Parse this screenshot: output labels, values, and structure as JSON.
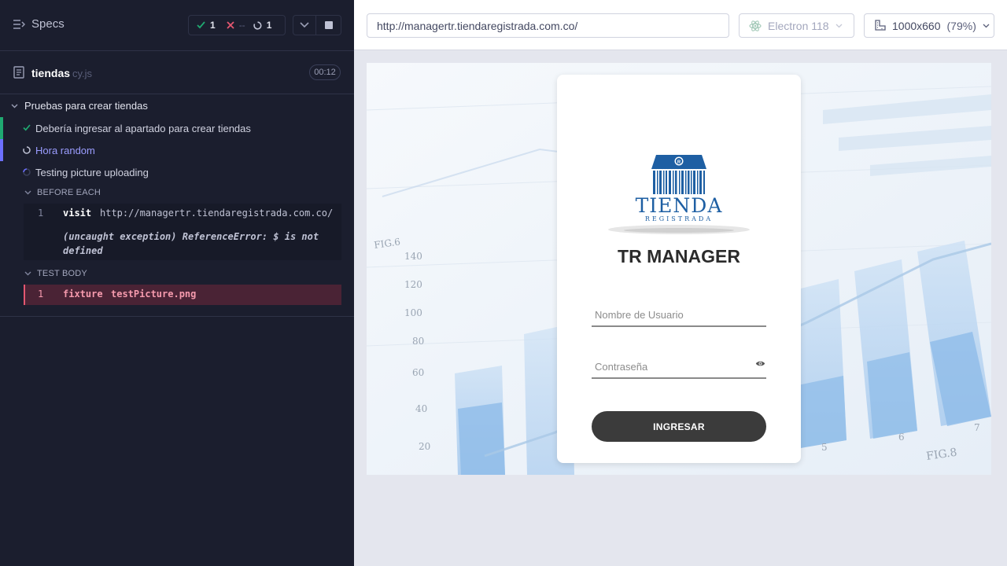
{
  "reporter": {
    "specs_label": "Specs",
    "stats": {
      "passed": "1",
      "failed": "--",
      "pending": "1"
    },
    "file": {
      "name": "tiendas",
      "ext": "cy.js",
      "duration": "00:12"
    },
    "suite_title": "Pruebas para crear tiendas",
    "tests": [
      {
        "title": "Debería ingresar al apartado para crear tiendas",
        "state": "passed"
      },
      {
        "title": "Hora random",
        "state": "pending"
      },
      {
        "title": "Testing picture uploading",
        "state": "running"
      }
    ],
    "hooks": {
      "before_each": {
        "title": "BEFORE EACH",
        "commands": [
          {
            "num": "1",
            "name": "visit",
            "message": "http://managertr.tiendaregistrada.com.co/"
          }
        ],
        "error": "(uncaught exception)  ReferenceError: $ is not defined"
      },
      "test_body": {
        "title": "TEST BODY",
        "commands": [
          {
            "num": "1",
            "name": "fixture",
            "message": "testPicture.png"
          }
        ]
      }
    }
  },
  "preview": {
    "url": "http://managertr.tiendaregistrada.com.co/",
    "browser": "Electron 118",
    "viewport": "1000x660",
    "scale": "(79%)"
  },
  "app": {
    "logo_main": "TIENDA",
    "logo_sub": "REGISTRADA",
    "title": "TR MANAGER",
    "username_placeholder": "Nombre de Usuario",
    "password_placeholder": "Contraseña",
    "login_button": "INGRESAR",
    "bg_tick_labels": [
      "140",
      "120",
      "100",
      "80",
      "60",
      "40",
      "20"
    ],
    "bg_fig_left": "FIG.6",
    "bg_fig_right": "FIG.8",
    "bg_x_labels": [
      "5",
      "6",
      "7"
    ]
  },
  "colors": {
    "pass": "#1fa971",
    "fail": "#e45770",
    "pending": "#8b8fff",
    "accent_bar_pass": "#1fa971",
    "accent_bar_pending": "#6c6fff"
  }
}
